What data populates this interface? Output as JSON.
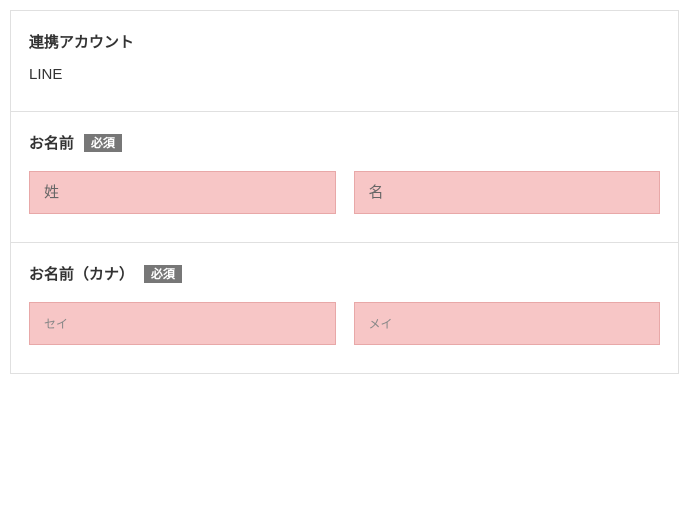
{
  "linkedAccount": {
    "title": "連携アカウント",
    "value": "LINE"
  },
  "name": {
    "title": "お名前",
    "required_label": "必須",
    "lastname_placeholder": "姓",
    "firstname_placeholder": "名"
  },
  "nameKana": {
    "title": "お名前（カナ）",
    "required_label": "必須",
    "lastname_placeholder": "セイ",
    "firstname_placeholder": "メイ"
  }
}
